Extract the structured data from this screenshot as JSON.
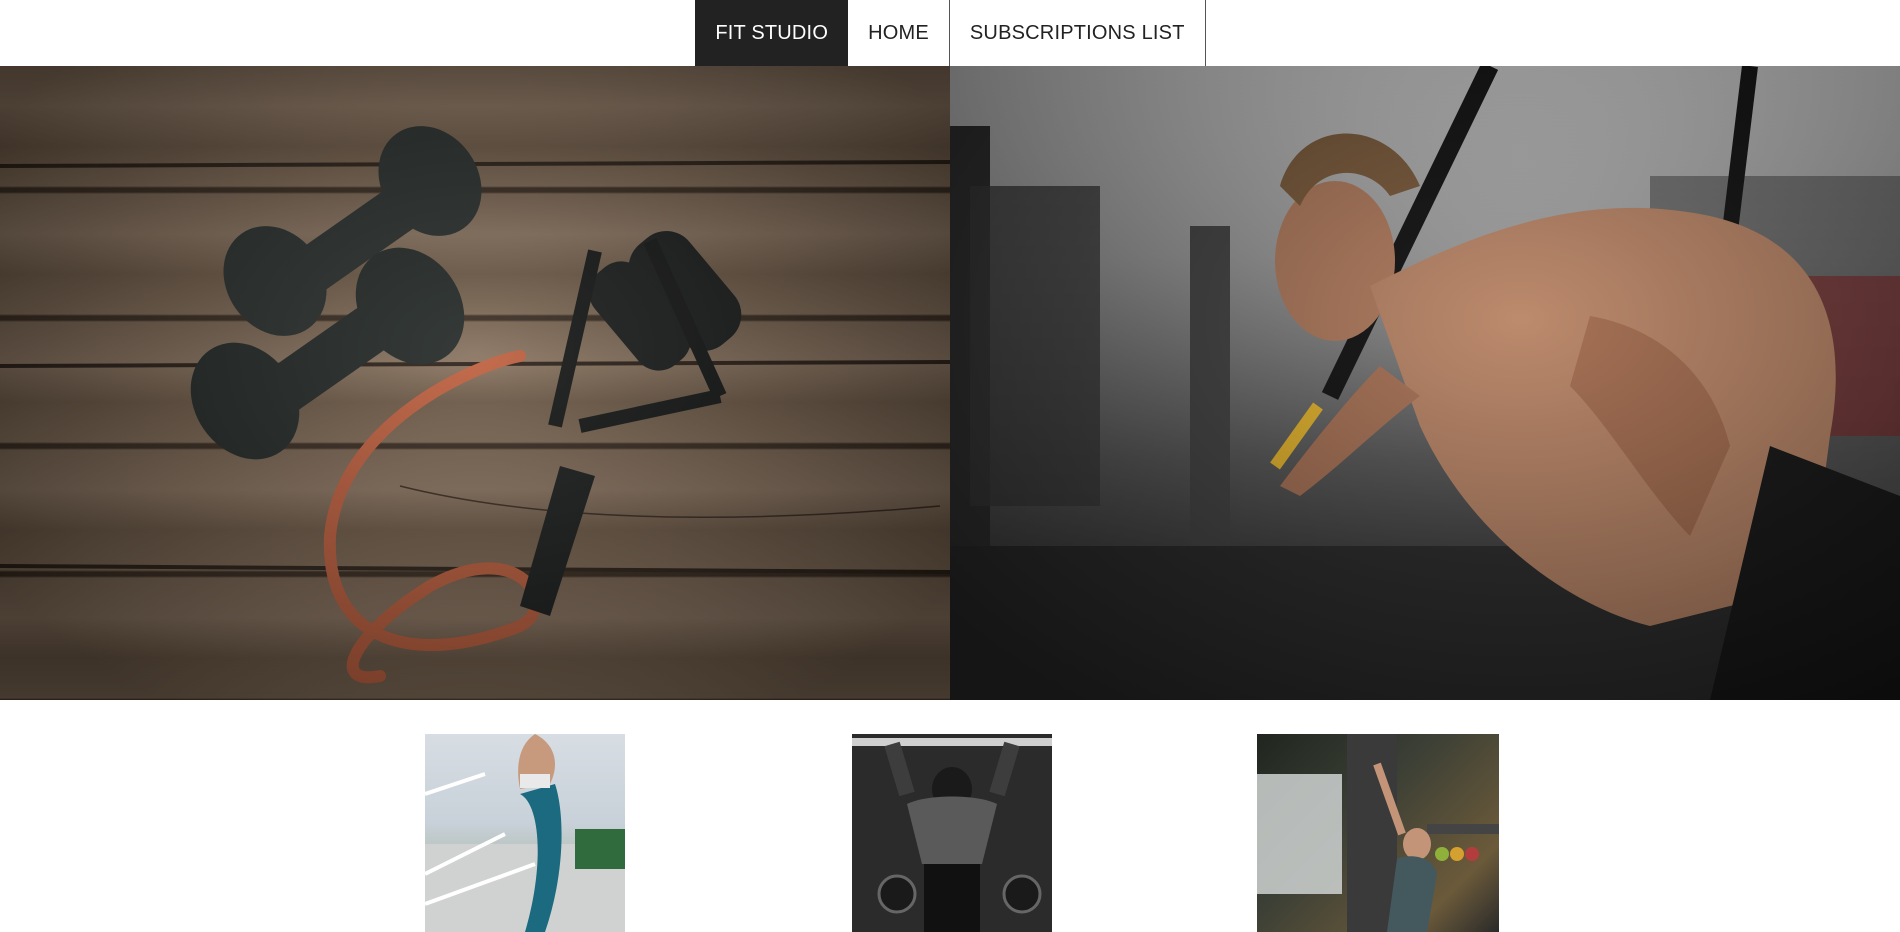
{
  "nav": {
    "brand": "FIT STUDIO",
    "items": [
      {
        "label": "HOME"
      },
      {
        "label": "SUBSCRIPTIONS LIST"
      }
    ]
  },
  "colors": {
    "nav_active_bg": "#222222",
    "band_orange": "#c0603f",
    "trx_yellow": "#e9b72c"
  },
  "icons": {
    "hero_left": "dumbbells-and-resistance-band-photo",
    "hero_right": "man-doing-suspension-training-photo",
    "thumb_1": "woman-running-stairs-photo",
    "thumb_2": "man-pull-ups-photo",
    "thumb_3": "woman-stretching-in-gym-photo"
  }
}
